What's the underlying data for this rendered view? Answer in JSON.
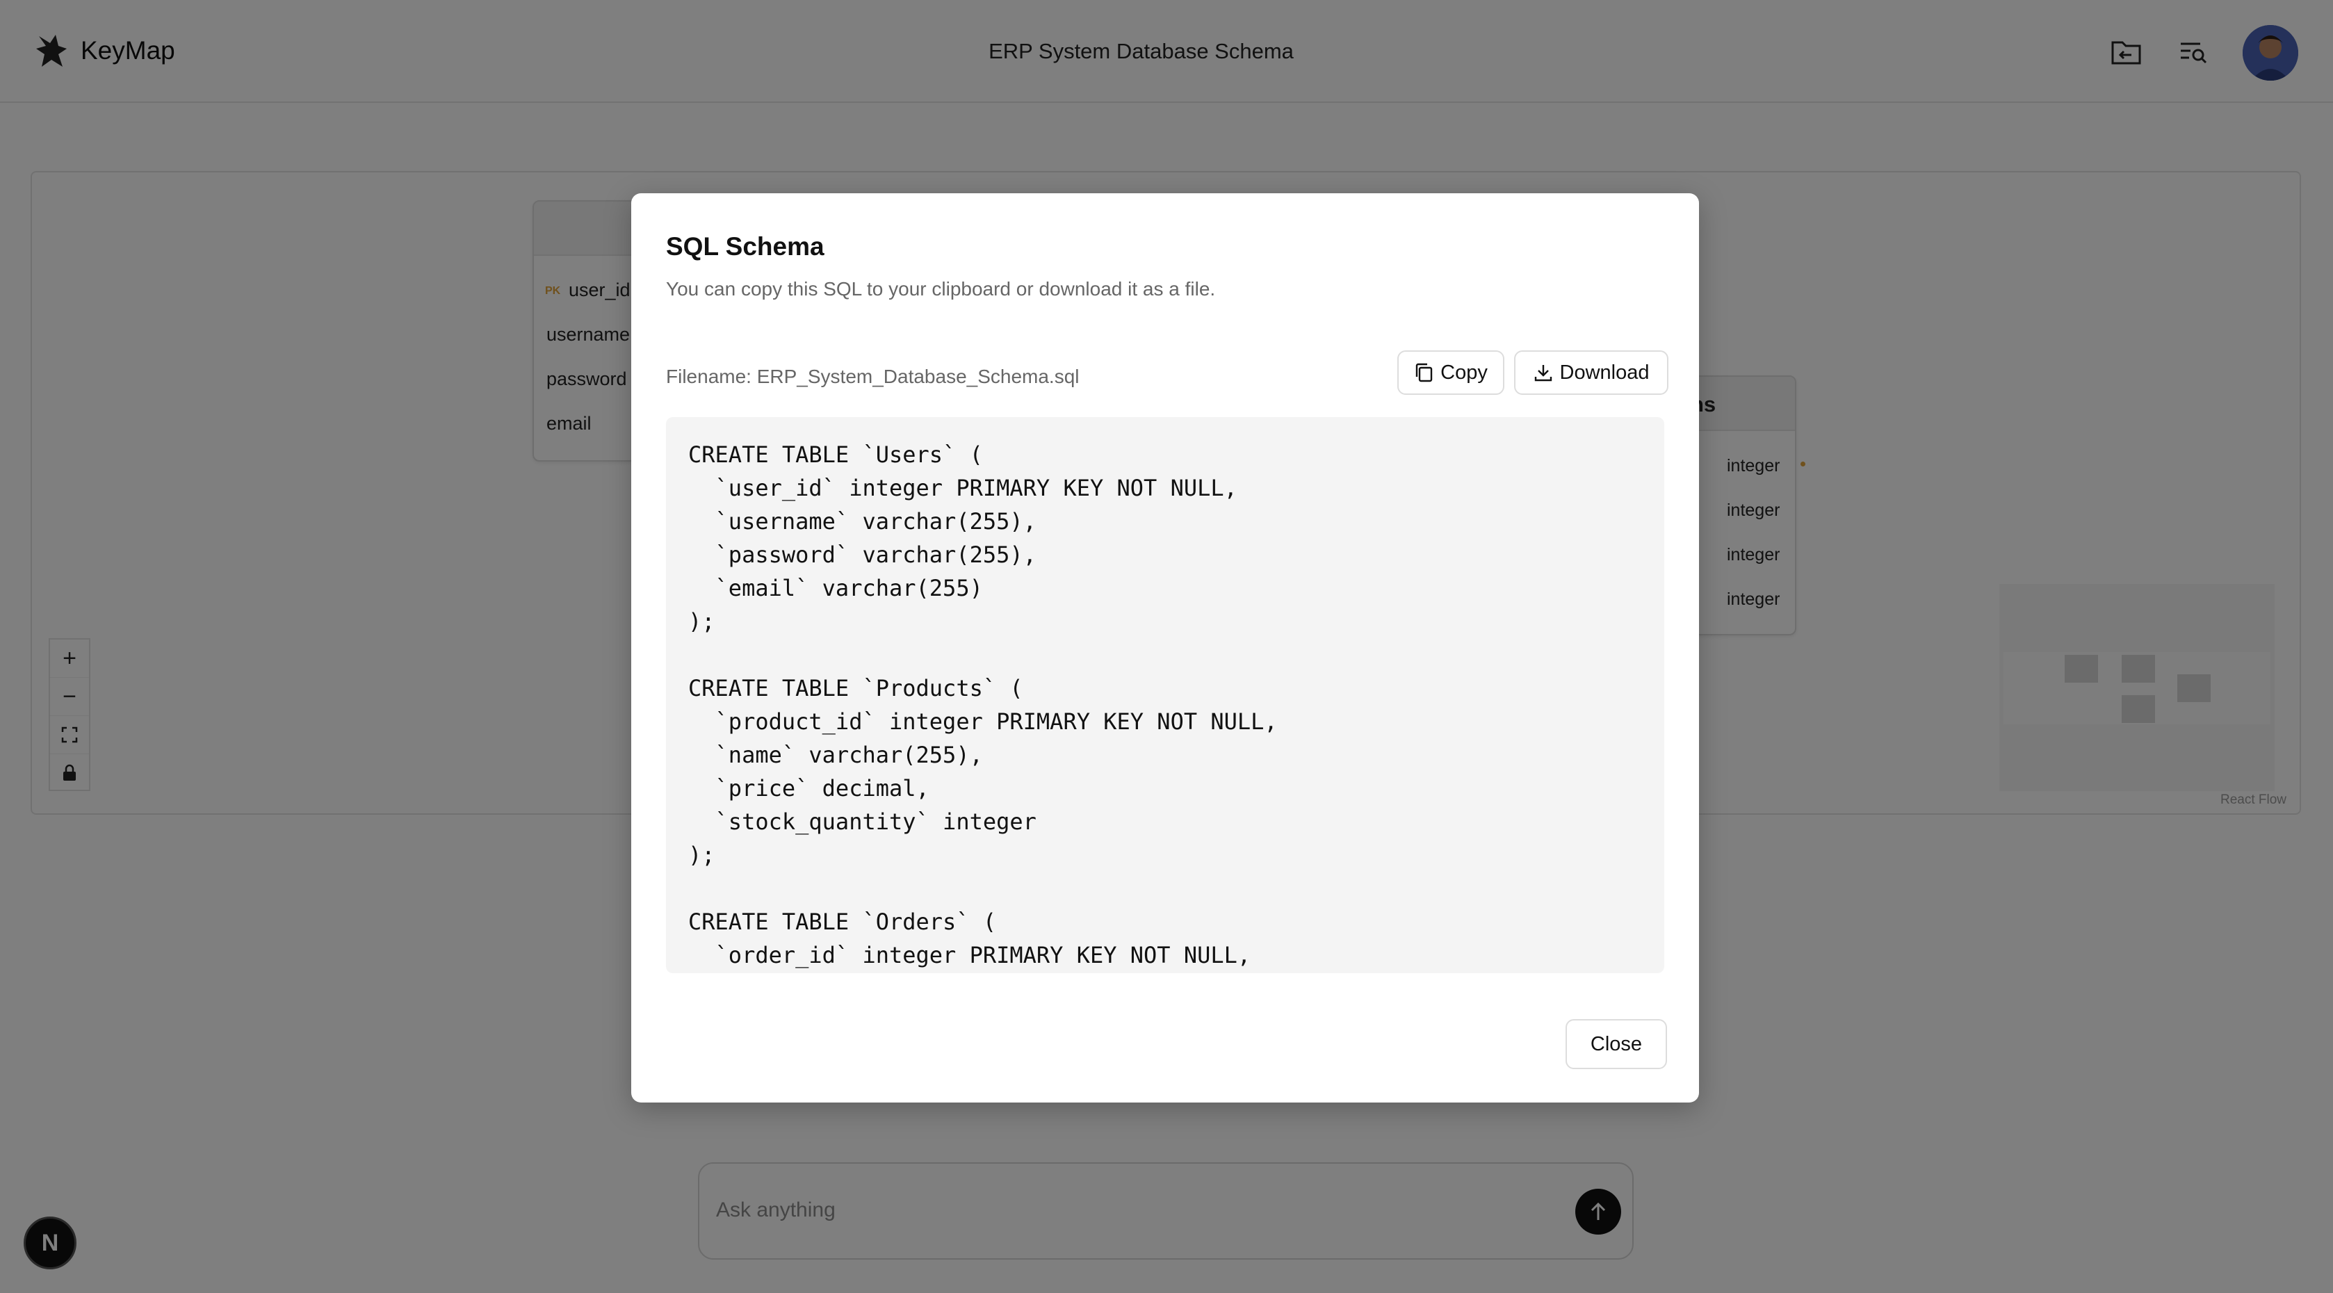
{
  "header": {
    "brand": "KeyMap",
    "title": "ERP System Database Schema",
    "icons": [
      "folder-back-icon",
      "search-list-icon"
    ],
    "avatar": "user-avatar"
  },
  "canvas": {
    "users_node": {
      "fields": [
        {
          "name": "user_id",
          "pk_label": "PK"
        },
        {
          "name": "username"
        },
        {
          "name": "password"
        },
        {
          "name": "email"
        }
      ]
    },
    "right_node": {
      "title_fragment": "ns",
      "types": [
        "integer",
        "integer",
        "integer",
        "integer"
      ]
    },
    "controls": [
      "+",
      "−",
      "⛶",
      "🔒"
    ],
    "attribution": "React Flow"
  },
  "ask": {
    "placeholder": "Ask anything"
  },
  "badge": "N",
  "modal": {
    "title": "SQL Schema",
    "description": "You can copy this SQL to your clipboard or download it as a file.",
    "filename_label": "Filename: ERP_System_Database_Schema.sql",
    "copy_label": "Copy",
    "download_label": "Download",
    "close_label": "Close",
    "code": "CREATE TABLE `Users` (\n  `user_id` integer PRIMARY KEY NOT NULL,\n  `username` varchar(255),\n  `password` varchar(255),\n  `email` varchar(255)\n);\n\nCREATE TABLE `Products` (\n  `product_id` integer PRIMARY KEY NOT NULL,\n  `name` varchar(255),\n  `price` decimal,\n  `stock_quantity` integer\n);\n\nCREATE TABLE `Orders` (\n  `order_id` integer PRIMARY KEY NOT NULL,"
  },
  "colors": {
    "overlay": "rgba(0,0,0,0.5)",
    "code_bg": "#f4f4f4",
    "pk_accent": "#e0a23a"
  }
}
